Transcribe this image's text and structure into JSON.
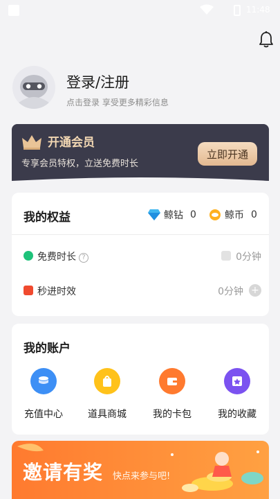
{
  "status_bar": {
    "time": "11:48"
  },
  "profile": {
    "title": "登录/注册",
    "subtitle": "点击登录 享受更多精彩信息"
  },
  "vip": {
    "title": "开通会员",
    "subtitle": "专享会员特权，立送免费时长",
    "button": "立即开通"
  },
  "rights": {
    "title": "我的权益",
    "diamond_label": "鲸钻",
    "diamond_count": "0",
    "coin_label": "鲸币",
    "coin_count": "0",
    "rows": [
      {
        "label": "免费时长",
        "value": "0分钟"
      },
      {
        "label": "秒进时效",
        "value": "0分钟"
      }
    ]
  },
  "account": {
    "title": "我的账户",
    "items": [
      {
        "label": "充值中心",
        "icon": "recharge-icon",
        "color": "#3d8ff5"
      },
      {
        "label": "道具商城",
        "icon": "shop-bag-icon",
        "color": "#ffc21a"
      },
      {
        "label": "我的卡包",
        "icon": "wallet-icon",
        "color": "#ff7a2f"
      },
      {
        "label": "我的收藏",
        "icon": "favorite-icon",
        "color": "#7b52f0"
      }
    ]
  },
  "banner": {
    "title": "邀请有奖",
    "subtitle": "快点来参与吧!"
  },
  "colors": {
    "vip_bg": "#3b3b4b",
    "vip_gold": "#f2d7b3",
    "banner_orange": "#ff7a2f",
    "free_time_green": "#1ec27a",
    "speed_red": "#f04a2f"
  }
}
